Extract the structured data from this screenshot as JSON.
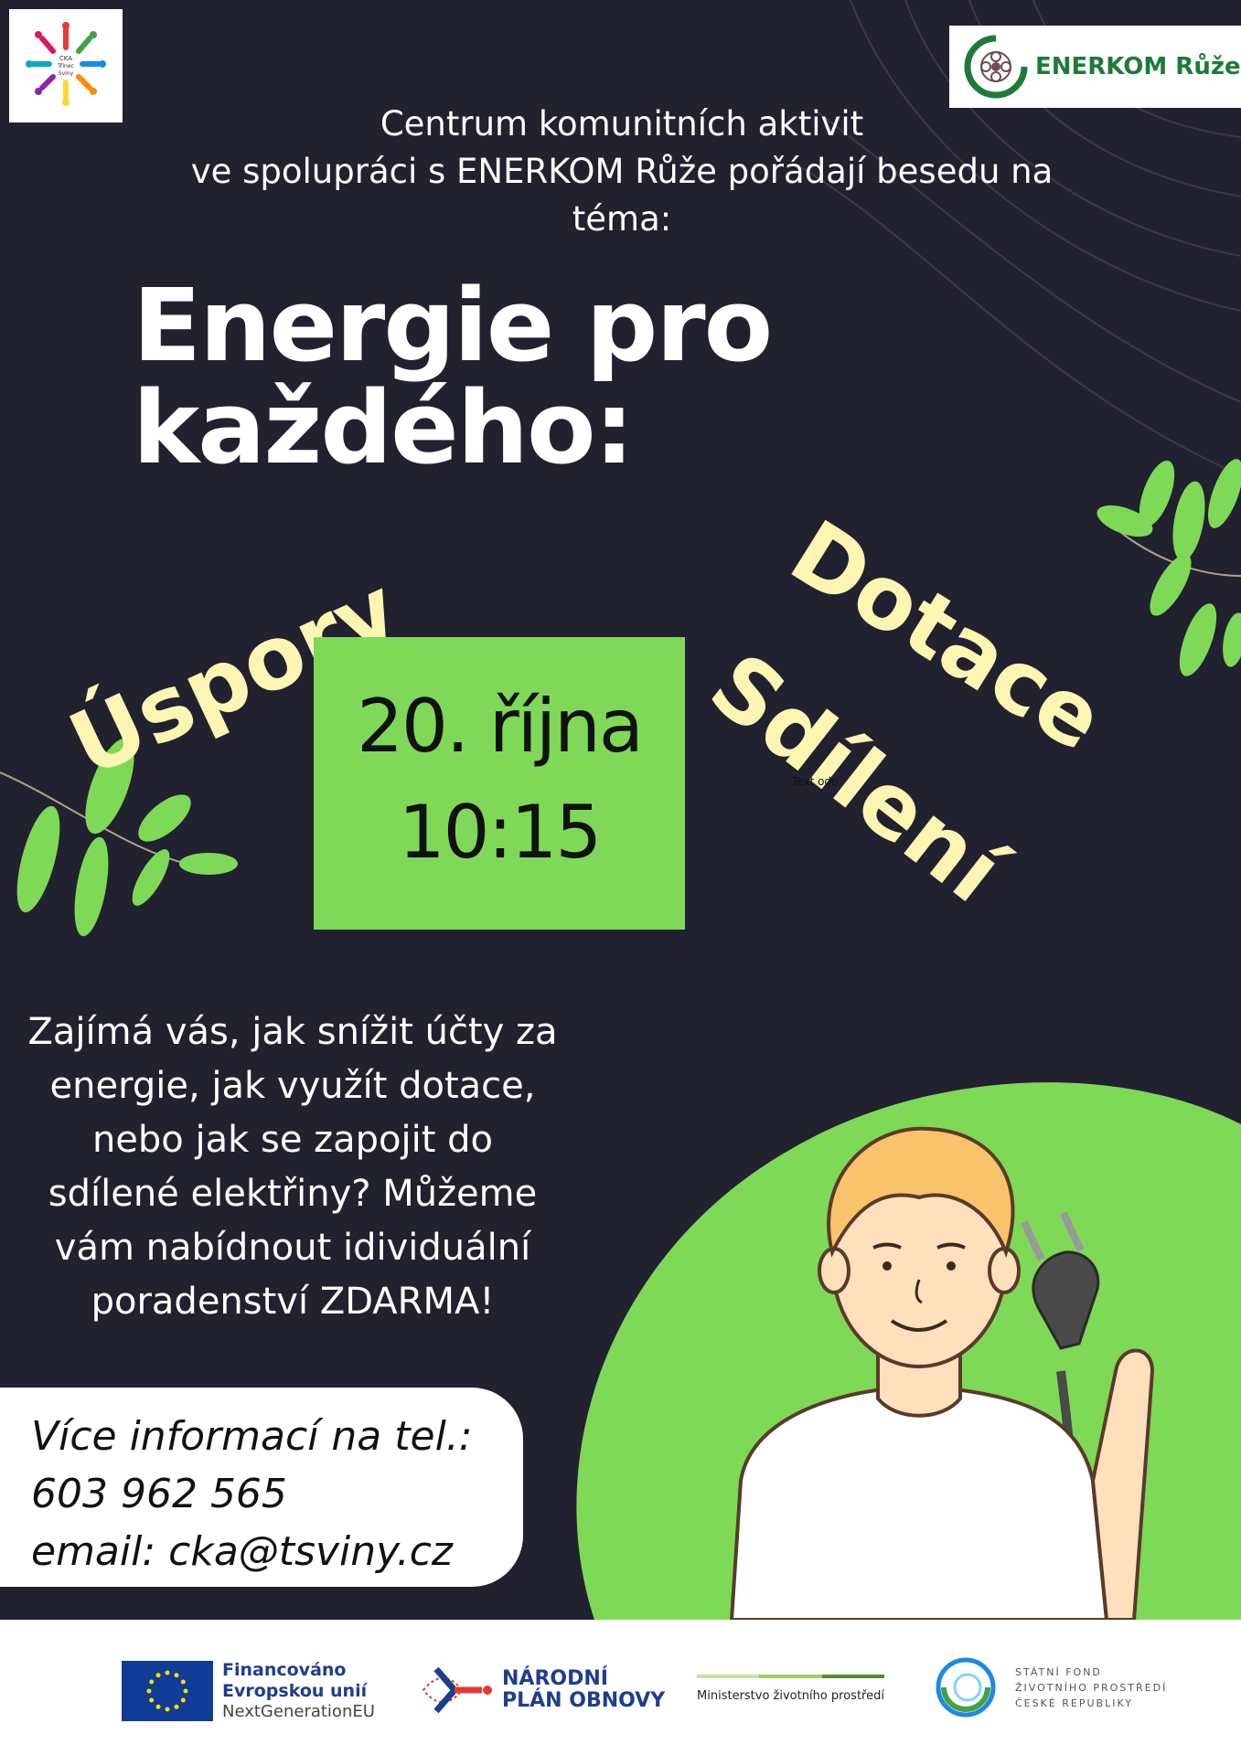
{
  "logos": {
    "cka_text": [
      "CKA",
      "Třinec",
      "Sviny"
    ],
    "enerkom": "ENERKOM Růže"
  },
  "intro": {
    "line1": "Centrum komunitních aktivit",
    "line2": "ve spolupráci s ENERKOM Růže pořádají besedu na",
    "line3": "téma:"
  },
  "title": {
    "line1": "Energie pro",
    "line2": "každého:"
  },
  "keywords": {
    "uspory": "Úspory",
    "dotace": "Dotace",
    "sdileni": "Sdílení"
  },
  "event": {
    "date": "20. října",
    "time": "10:15"
  },
  "stray_text": "Text odo",
  "body": {
    "lines": [
      "Zajímá vás, jak snížit účty za",
      "energie, jak využít dotace,",
      "nebo jak se zapojit do",
      "sdílené elektřiny? Můžeme",
      "vám nabídnout idividuální",
      "poradenství ZDARMA!"
    ]
  },
  "contact": {
    "line1": "Více informací na tel.:",
    "phone": "603 962 565",
    "email": "email: cka@tsviny.cz"
  },
  "footer": {
    "eu": {
      "line1": "Financováno",
      "line2": "Evropskou unií",
      "line3": "NextGenerationEU"
    },
    "npo": {
      "line1": "NÁRODNÍ",
      "line2": "PLÁN OBNOVY"
    },
    "mzp": "Ministerstvo životního prostředí",
    "sfzp": {
      "line1": "STÁTNÍ FOND",
      "line2": "ŽIVOTNÍHO PROSTŘEDÍ",
      "line3": "ČESKÉ REPUBLIKY"
    }
  },
  "colors": {
    "background": "#22212f",
    "accent_green": "#7fd857",
    "keyword_yellow": "#fdf6b3",
    "leaf_green": "#7ed957"
  }
}
